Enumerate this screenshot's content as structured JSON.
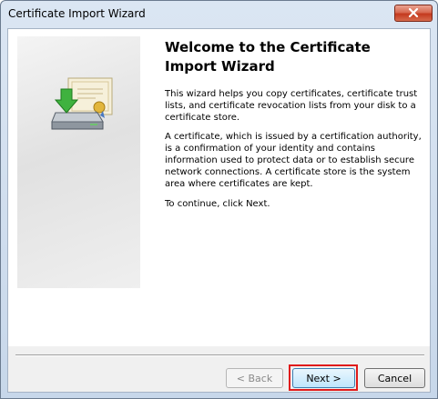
{
  "window": {
    "title": "Certificate Import Wizard"
  },
  "wizard": {
    "heading": "Welcome to the Certificate Import Wizard",
    "paragraph_1": "This wizard helps you copy certificates, certificate trust lists, and certificate revocation lists from your disk to a certificate store.",
    "paragraph_2": "A certificate, which is issued by a certification authority, is a confirmation of your identity and contains information used to protect data or to establish secure network connections. A certificate store is the system area where certificates are kept.",
    "paragraph_3": "To continue, click Next."
  },
  "buttons": {
    "back_label": "< Back",
    "next_label": "Next >",
    "cancel_label": "Cancel"
  },
  "icons": {
    "close": "close-icon",
    "wizard_graphic": "certificate-import-icon"
  },
  "colors": {
    "highlight": "#e01b1b",
    "close_button": "#c4391e"
  }
}
